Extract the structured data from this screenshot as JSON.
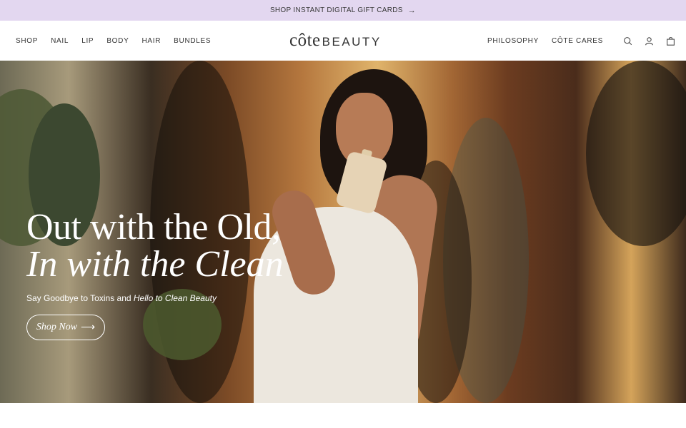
{
  "announcement": {
    "text": "SHOP INSTANT DIGITAL GIFT CARDS",
    "arrow": "→"
  },
  "nav": {
    "left": [
      "SHOP",
      "NAIL",
      "LIP",
      "BODY",
      "HAIR",
      "BUNDLES"
    ],
    "right": [
      "PHILOSOPHY",
      "CÔTE CARES"
    ]
  },
  "logo": {
    "part1": "côte",
    "part2": "BEAUTY"
  },
  "icons": [
    "search-icon",
    "account-icon",
    "cart-icon"
  ],
  "hero": {
    "headline_line1": "Out with the Old,",
    "headline_line2": "In with the Clean",
    "subline_plain": "Say Goodbye to Toxins and ",
    "subline_italic": "Hello to Clean Beauty",
    "cta_label": "Shop Now",
    "cta_arrow": "⟶"
  },
  "colors": {
    "announce_bg": "#e3d7f0",
    "text": "#333333",
    "hero_text": "#ffffff"
  }
}
